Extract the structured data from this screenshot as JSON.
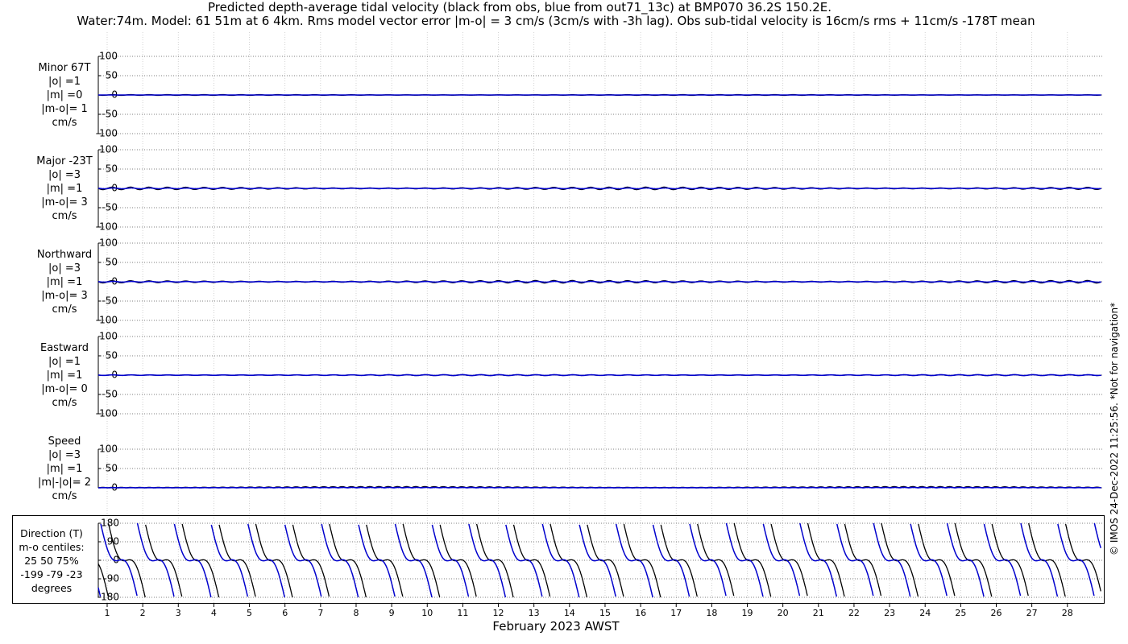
{
  "title_line1": "Predicted depth-average tidal velocity (black from obs, blue from out71_13c) at BMP070 36.2S 150.2E.",
  "title_line2": "Water:74m. Model: 61 51m at 6 4km. Rms model vector error |m-o| = 3 cm/s (3cm/s with -3h lag). Obs sub-tidal velocity is 16cm/s rms + 11cm/s -178T mean",
  "copyright": "© IMOS 24-Dec-2022 11:25:56. *Not for navigation*",
  "panels": [
    {
      "lines": [
        "Minor 67T",
        "|o| =1",
        "|m| =0",
        "|m-o|= 1",
        "cm/s"
      ]
    },
    {
      "lines": [
        "Major -23T",
        "|o| =3",
        "|m| =1",
        "|m-o|= 3",
        "cm/s"
      ]
    },
    {
      "lines": [
        "Northward",
        "|o| =3",
        "|m| =1",
        "|m-o|= 3",
        "cm/s"
      ]
    },
    {
      "lines": [
        "Eastward",
        "|o| =1",
        "|m| =1",
        "|m-o|= 0",
        "cm/s"
      ]
    },
    {
      "lines": [
        "Speed",
        "|o| =3",
        "|m| =1",
        "|m|-|o|= 2",
        "cm/s"
      ]
    },
    {
      "lines": [
        "Direction (T)",
        "m-o centiles:",
        "25  50  75%",
        "-199  -79  -23",
        "degrees"
      ]
    }
  ],
  "chart_data": {
    "type": "line",
    "xlabel": "February 2023 AWST",
    "x_ticks": [
      "1",
      "2",
      "3",
      "4",
      "5",
      "6",
      "7",
      "8",
      "9",
      "10",
      "11",
      "12",
      "13",
      "14",
      "15",
      "16",
      "17",
      "18",
      "19",
      "20",
      "21",
      "22",
      "23",
      "24",
      "25",
      "26",
      "27",
      "28"
    ],
    "velocity_yticks": [
      "100",
      "50",
      "0",
      "-50",
      "-100"
    ],
    "speed_yticks": [
      "100",
      "50",
      "0"
    ],
    "direction_yticks": [
      "180",
      "90",
      "0",
      "-90",
      "-180"
    ],
    "series": [
      {
        "name": "obs",
        "color": "#000000"
      },
      {
        "name": "out71_13c",
        "color": "#0000cc"
      }
    ],
    "amplitudes_cm_s": {
      "minor": {
        "obs": 1,
        "model": 0
      },
      "major": {
        "obs": 3,
        "model": 1
      },
      "northward": {
        "obs": 3,
        "model": 1
      },
      "eastward": {
        "obs": 1,
        "model": 1
      },
      "speed": {
        "obs": 3,
        "model": 1
      }
    },
    "direction_range_deg": [
      -180,
      180
    ]
  }
}
